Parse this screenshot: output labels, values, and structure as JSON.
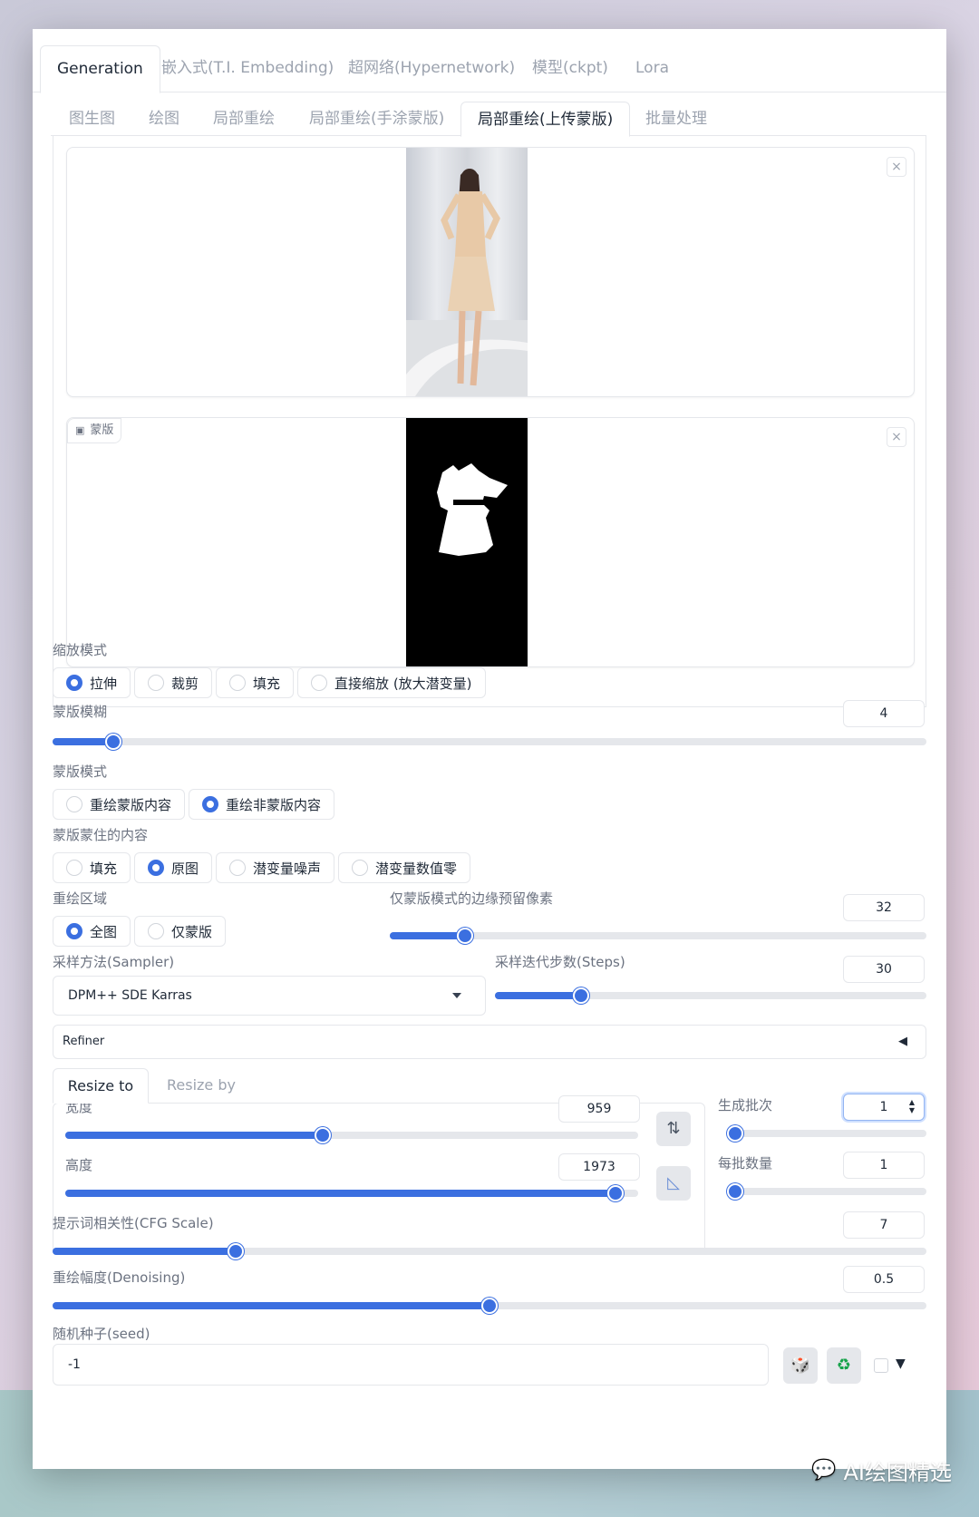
{
  "tabs_main": [
    {
      "label": "Generation",
      "active": true
    },
    {
      "label": "嵌入式(T.I. Embedding)"
    },
    {
      "label": "超网络(Hypernetwork)"
    },
    {
      "label": "模型(ckpt)"
    },
    {
      "label": "Lora"
    }
  ],
  "tabs_sub": [
    {
      "label": "图生图"
    },
    {
      "label": "绘图"
    },
    {
      "label": "局部重绘"
    },
    {
      "label": "局部重绘(手涂蒙版)"
    },
    {
      "label": "局部重绘(上传蒙版)",
      "active": true
    },
    {
      "label": "批量处理"
    }
  ],
  "images": {
    "close_glyph": "×",
    "mask_label": "蒙版"
  },
  "resize_mode": {
    "label": "缩放模式",
    "options": [
      "拉伸",
      "裁剪",
      "填充",
      "直接缩放 (放大潜变量)"
    ],
    "selected": "拉伸"
  },
  "mask_blur": {
    "label": "蒙版模糊",
    "value": "4",
    "fraction": 0.07
  },
  "mask_mode": {
    "label": "蒙版模式",
    "options": [
      "重绘蒙版内容",
      "重绘非蒙版内容"
    ],
    "selected": "重绘非蒙版内容"
  },
  "masked_content": {
    "label": "蒙版蒙住的内容",
    "options": [
      "填充",
      "原图",
      "潜变量噪声",
      "潜变量数值零"
    ],
    "selected": "原图"
  },
  "inpaint_area": {
    "label": "重绘区域",
    "options": [
      "全图",
      "仅蒙版"
    ],
    "selected": "全图"
  },
  "padding": {
    "label": "仅蒙版模式的边缘预留像素",
    "value": "32",
    "fraction": 0.14
  },
  "sampler": {
    "label": "采样方法(Sampler)",
    "value": "DPM++ SDE Karras"
  },
  "steps": {
    "label": "采样迭代步数(Steps)",
    "value": "30",
    "fraction": 0.2
  },
  "refiner": {
    "label": "Refiner",
    "arrow": "◀"
  },
  "resize_tabs": [
    {
      "label": "Resize to",
      "active": true
    },
    {
      "label": "Resize by"
    }
  ],
  "width": {
    "label": "宽度",
    "value": "959",
    "fraction": 0.45
  },
  "height": {
    "label": "高度",
    "value": "1973",
    "fraction": 0.96
  },
  "batch_count": {
    "label": "生成批次",
    "value": "1",
    "fraction": 0.0
  },
  "batch_size": {
    "label": "每批数量",
    "value": "1",
    "fraction": 0.0
  },
  "cfg": {
    "label": "提示词相关性(CFG Scale)",
    "value": "7",
    "fraction": 0.21
  },
  "denoise": {
    "label": "重绘幅度(Denoising)",
    "value": "0.5",
    "fraction": 0.5
  },
  "seed": {
    "label": "随机种子(seed)",
    "value": "-1"
  },
  "icons": {
    "swap": "⇅",
    "ratio": "◺",
    "dice": "🎲",
    "recycle": "♻",
    "caret": "▼",
    "spin_up": "▲",
    "spin_down": "▼"
  },
  "watermark": "AI绘图精选",
  "colors": {
    "accent": "#3b6fe0"
  }
}
